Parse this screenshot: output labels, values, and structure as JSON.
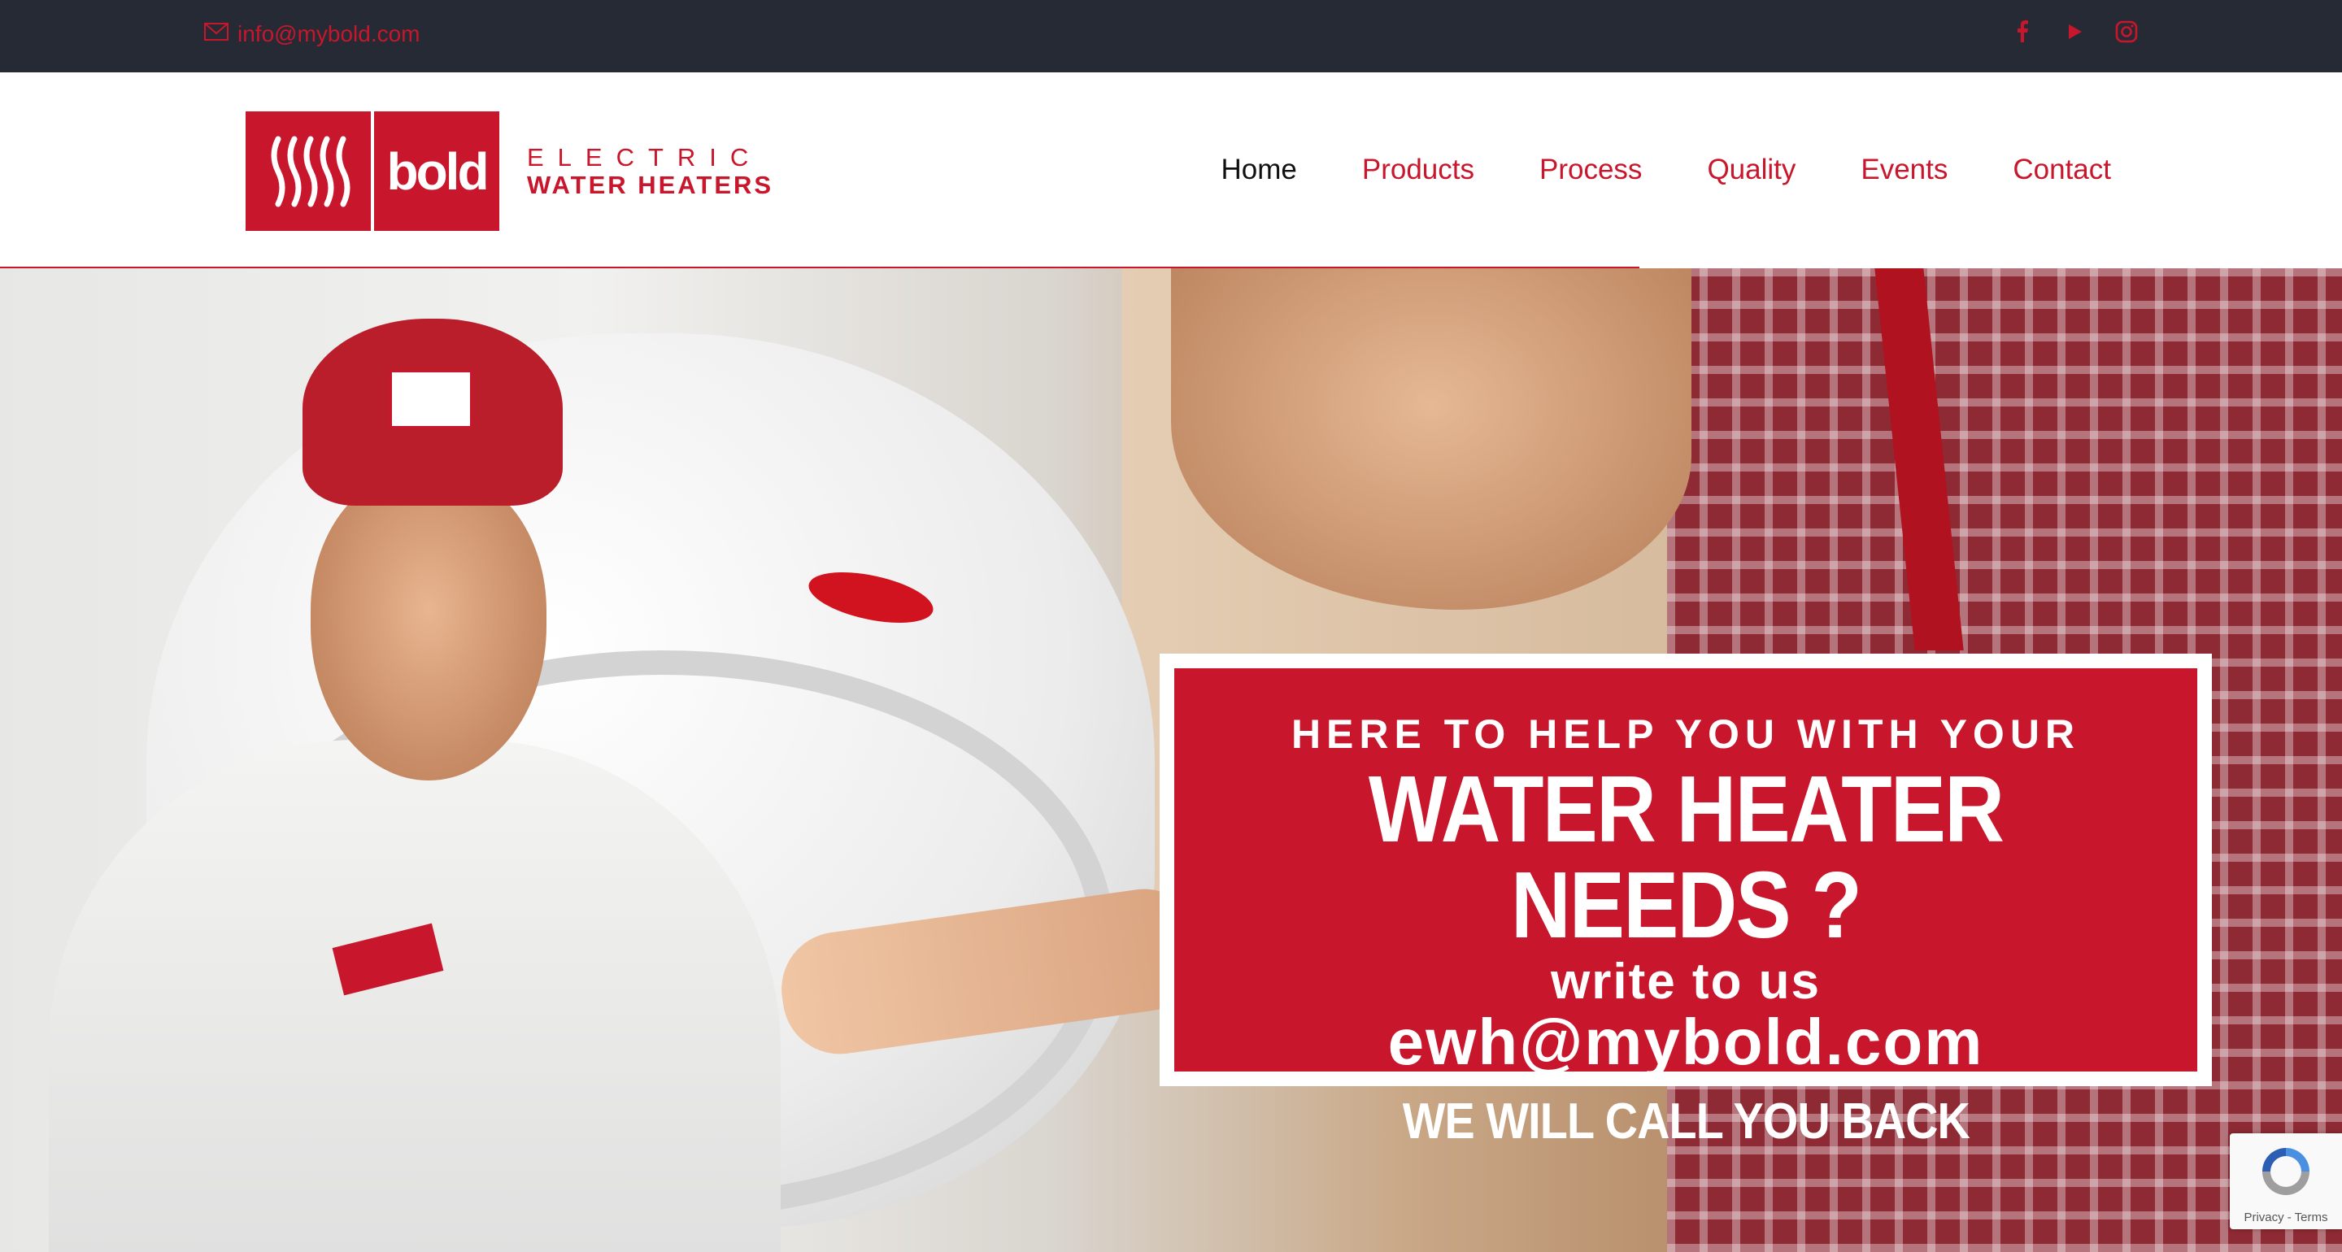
{
  "topbar": {
    "email": "info@mybold.com",
    "social": [
      "facebook-icon",
      "youtube-icon",
      "instagram-icon"
    ]
  },
  "logo": {
    "mark": "bold",
    "line1": "ELECTRIC",
    "line2": "WATER HEATERS"
  },
  "nav": {
    "items": [
      {
        "label": "Home",
        "active": true
      },
      {
        "label": "Products",
        "active": false
      },
      {
        "label": "Process",
        "active": false
      },
      {
        "label": "Quality",
        "active": false
      },
      {
        "label": "Events",
        "active": false
      },
      {
        "label": "Contact",
        "active": false
      }
    ]
  },
  "slider": {
    "progress": 0.7
  },
  "hero": {
    "line1": "HERE TO HELP YOU WITH YOUR",
    "line2": "WATER HEATER NEEDS ?",
    "line3": "write to us",
    "line4": "ewh@mybold.com",
    "line5": "WE WILL CALL YOU BACK"
  },
  "recaptcha": {
    "terms": "Privacy - Terms"
  },
  "colors": {
    "brand": "#c8162c",
    "topbar": "#262a34",
    "nav_active": "#111111"
  }
}
